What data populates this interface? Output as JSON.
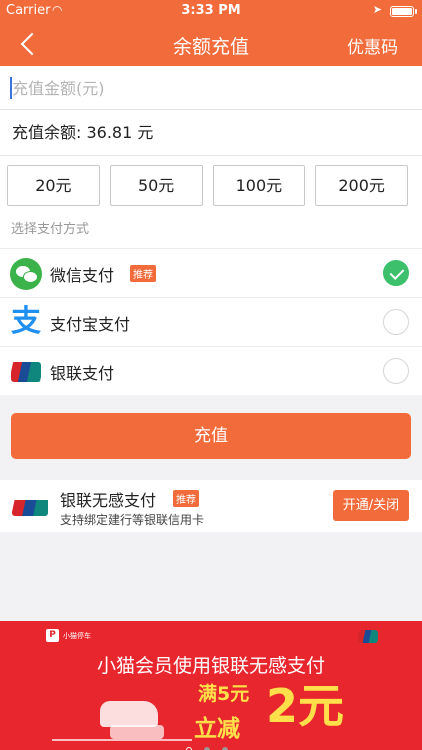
{
  "status": {
    "carrier": "Carrier",
    "time": "3:33 PM"
  },
  "nav": {
    "title": "余额充值",
    "right": "优惠码"
  },
  "amount": {
    "placeholder": "充值金额(元)"
  },
  "balance": {
    "text": "充值余额: 36.81 元"
  },
  "presets": [
    "20元",
    "50元",
    "100元",
    "200元"
  ],
  "payment": {
    "section_label": "选择支付方式",
    "items": [
      {
        "label": "微信支付",
        "tag": "推荐",
        "icon": "wechat-icon",
        "selected": true
      },
      {
        "label": "支付宝支付",
        "icon": "alipay-icon",
        "selected": false
      },
      {
        "label": "银联支付",
        "icon": "unionpay-icon",
        "selected": false
      }
    ]
  },
  "recharge_button": "充值",
  "nfc": {
    "title": "银联无感支付",
    "tag": "推荐",
    "subtitle": "支持绑定建行等银联信用卡",
    "button": "开通/关闭"
  },
  "banner": {
    "brand": "小猫停车",
    "headline": "小猫会员使用银联无感支付",
    "line1": "满5元",
    "line2": "立减",
    "big": "2元",
    "page_count": 3,
    "active_page": 1
  },
  "colors": {
    "accent": "#f26b3a",
    "selected": "#3cc06b",
    "banner": "#e8262d"
  }
}
